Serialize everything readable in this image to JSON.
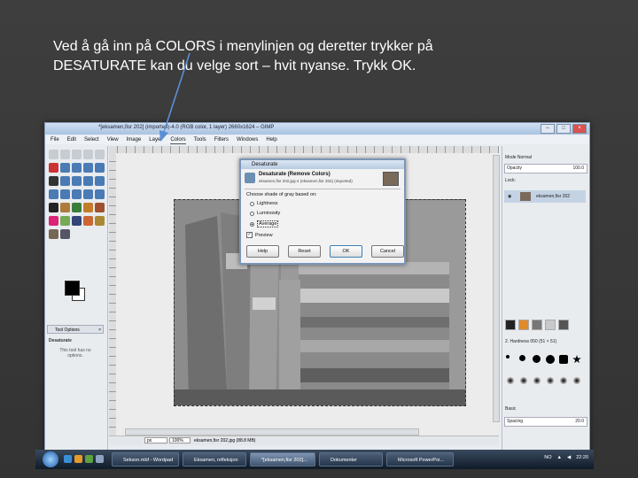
{
  "caption": {
    "line1": "Ved å gå inn på COLORS i menylinjen og deretter trykker på",
    "line2": "DESATURATE kan du velge sort – hvit nyanse. Trykk OK."
  },
  "gimp": {
    "title": "*[eksamen,fisr 202] (imported)-4.0 (RGB color, 1 layer) 2660x1624 – GIMP",
    "menu": [
      "File",
      "Edit",
      "Select",
      "View",
      "Image",
      "Layer",
      "Colors",
      "Tools",
      "Filters",
      "Windows",
      "Help"
    ],
    "active_menu": "Colors",
    "toolbox": {
      "tab_label": "Tool Options",
      "options_title": "Desaturate",
      "options_note": "This tool has no options."
    },
    "status": {
      "zoom": "px",
      "zoom_value": "100%",
      "file_info": "eksamen,fisr 202.jpg (88.8 MB)"
    },
    "dock": {
      "mode_label": "Mode Normal",
      "opacity_label": "Opacity",
      "opacity_value": "100.0",
      "lock_label": "Lock:",
      "layer_name": "eksamen,fisr 202",
      "brush_label": "2. Hardness 050 (51 × 51)",
      "basic_label": "Basic",
      "spacing_label": "Spacing",
      "spacing_value": "20.0"
    }
  },
  "dialog": {
    "title": "Desaturate",
    "heading": "Desaturate (Remove Colors)",
    "subheading": "eksamen,fisr 202.jpg-4 (eksamen,fisr 202) (imported)",
    "group_label": "Choose shade of gray based on:",
    "options": [
      {
        "label": "Lightness",
        "selected": false
      },
      {
        "label": "Luminosity",
        "selected": false
      },
      {
        "label": "Average",
        "selected": true
      }
    ],
    "preview_label": "Preview",
    "preview_checked": true,
    "buttons": {
      "help": "Help",
      "reset": "Reset",
      "ok": "OK",
      "cancel": "Cancel"
    }
  },
  "taskbar": {
    "tasks": [
      {
        "label": "Sekson.mbf - Wordpad",
        "active": false
      },
      {
        "label": "Eksamen, refleksjon",
        "active": false
      },
      {
        "label": "*[eksamen,fisr 202]...",
        "active": true
      },
      {
        "label": "Dokumenter",
        "active": false
      },
      {
        "label": "Microsoft PowerPoi...",
        "active": false
      }
    ],
    "language": "NO",
    "clock": "22:20"
  },
  "colors": {
    "accent": "#3c7fb1",
    "arrow": "#5a8fd6",
    "slide_bg": "#3a3a3a"
  }
}
